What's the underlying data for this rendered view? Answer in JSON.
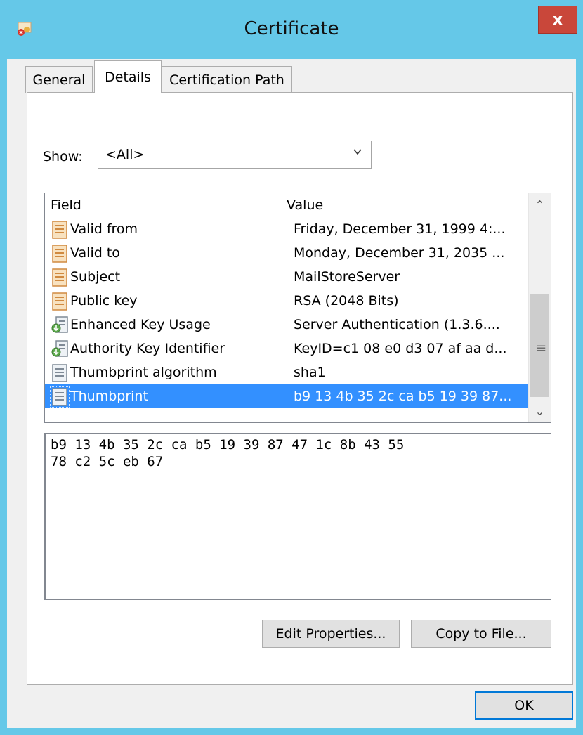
{
  "window": {
    "title": "Certificate",
    "close_label": "x"
  },
  "tabs": [
    {
      "label": "General"
    },
    {
      "label": "Details",
      "selected": true
    },
    {
      "label": "Certification Path"
    }
  ],
  "show": {
    "label": "Show:",
    "selected": "<All>"
  },
  "list": {
    "headers": {
      "field": "Field",
      "value": "Value"
    },
    "rows": [
      {
        "icon": "certificate-field-icon",
        "field": "Valid from",
        "value": "Friday, December 31, 1999 4:..."
      },
      {
        "icon": "certificate-field-icon",
        "field": "Valid to",
        "value": "Monday, December 31, 2035 ..."
      },
      {
        "icon": "certificate-field-icon",
        "field": "Subject",
        "value": "MailStoreServer"
      },
      {
        "icon": "certificate-field-icon",
        "field": "Public key",
        "value": "RSA (2048 Bits)"
      },
      {
        "icon": "extension-download-icon",
        "field": "Enhanced Key Usage",
        "value": "Server Authentication (1.3.6...."
      },
      {
        "icon": "extension-download-icon",
        "field": "Authority Key Identifier",
        "value": "KeyID=c1 08 e0 d3 07 af aa d..."
      },
      {
        "icon": "property-icon",
        "field": "Thumbprint algorithm",
        "value": "sha1"
      },
      {
        "icon": "property-icon",
        "field": "Thumbprint",
        "value": "b9 13 4b 35 2c ca b5 19 39 87...",
        "selected": true
      }
    ]
  },
  "value_box": {
    "text": "b9 13 4b 35 2c ca b5 19 39 87 47 1c 8b 43 55\n78 c2 5c eb 67"
  },
  "buttons": {
    "edit_properties": "Edit Properties...",
    "copy_to_file": "Copy to File...",
    "ok": "OK"
  },
  "colors": {
    "titlebar": "#65c8e8",
    "close": "#c9473a",
    "selection": "#3390ff"
  }
}
